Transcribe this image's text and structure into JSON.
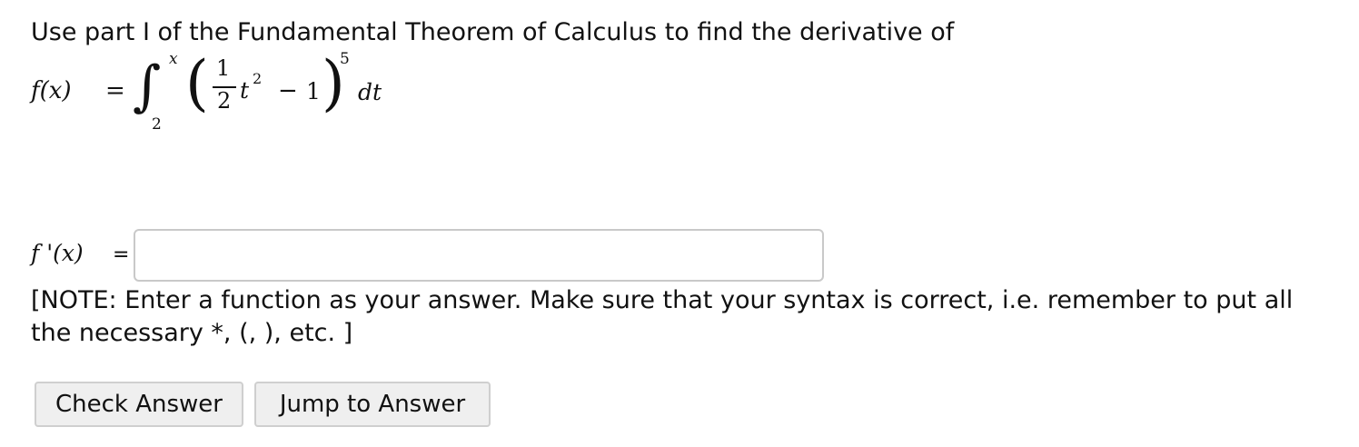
{
  "question": {
    "prompt": "Use part I of the Fundamental Theorem of Calculus to find the derivative of"
  },
  "formula": {
    "lhs": "f(x)",
    "equals": "=",
    "integral_sign": "∫",
    "upper_limit": "x",
    "lower_limit": "2",
    "left_paren": "(",
    "frac_numerator": "1",
    "frac_denominator": "2",
    "variable": "t",
    "variable_exponent": "2",
    "minus": "−",
    "constant": "1",
    "right_paren": ")",
    "outer_exponent": "5",
    "differential": "dt"
  },
  "answer": {
    "label": "f '(x)",
    "equals": "=",
    "value": "",
    "placeholder": ""
  },
  "note": "[NOTE: Enter a function as your answer. Make sure that your syntax is correct, i.e. remember to put all the necessary *, (, ), etc. ]",
  "buttons": {
    "check_label": "Check Answer",
    "jump_label": "Jump to Answer"
  }
}
